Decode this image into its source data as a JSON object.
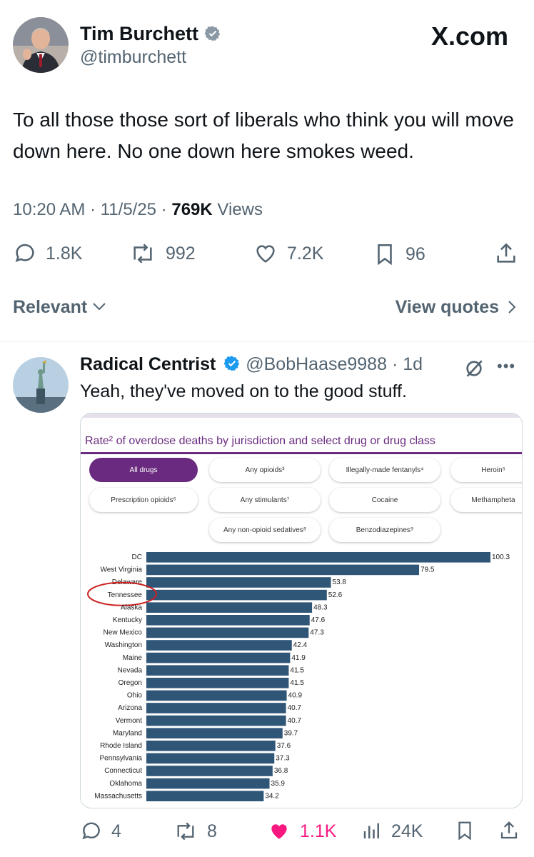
{
  "post": {
    "author_name": "Tim Burchett",
    "author_handle": "@timburchett",
    "brand": "X.com",
    "text": "To all those those sort of liberals who think you will move down here. No one down here smokes weed.",
    "time": "10:20 AM",
    "date": "11/5/25",
    "views_count": "769K",
    "views_label": "Views",
    "actions": {
      "replies": "1.8K",
      "reposts": "992",
      "likes": "7.2K",
      "bookmarks": "96"
    }
  },
  "filter": {
    "sort_label": "Relevant",
    "view_quotes": "View quotes"
  },
  "reply": {
    "author_name": "Radical Centrist",
    "author_handle": "@BobHaase9988",
    "age": "1d",
    "text": "Yeah, they've moved on to the good stuff.",
    "actions": {
      "replies": "4",
      "reposts": "8",
      "likes": "1.1K",
      "views": "24K"
    }
  },
  "chart_card": {
    "title": "Rate² of overdose deaths by jurisdiction and select drug or drug class",
    "pills": [
      "All drugs",
      "Any opioids³",
      "Illegally-made fentanyls⁴",
      "Heroin⁵",
      "Prescription opioids⁶",
      "Any stimulants⁷",
      "Cocaine",
      "Methampheta",
      "Any non-opioid sedatives⁸",
      "Benzodiazepines⁹"
    ]
  },
  "chart_data": {
    "type": "bar",
    "orientation": "horizontal",
    "title": "Rate² of overdose deaths by jurisdiction and select drug or drug class",
    "categories": [
      "DC",
      "West Virginia",
      "Delaware",
      "Tennessee",
      "Alaska",
      "Kentucky",
      "New Mexico",
      "Washington",
      "Maine",
      "Nevada",
      "Oregon",
      "Ohio",
      "Arizona",
      "Vermont",
      "Maryland",
      "Rhode Island",
      "Pennsylvania",
      "Connecticut",
      "Oklahoma",
      "Massachusetts"
    ],
    "values": [
      100.3,
      79.5,
      53.8,
      52.6,
      48.3,
      47.6,
      47.3,
      42.4,
      41.9,
      41.5,
      41.5,
      40.9,
      40.7,
      40.7,
      39.7,
      37.6,
      37.3,
      36.8,
      35.9,
      34.2
    ],
    "highlighted": "Tennessee",
    "bar_color": "#2f5577",
    "highlight_color": "#cc2222"
  },
  "colors": {
    "accent": "#1d9bf0",
    "like": "#f91880",
    "chart_purple": "#6a2a7f"
  }
}
